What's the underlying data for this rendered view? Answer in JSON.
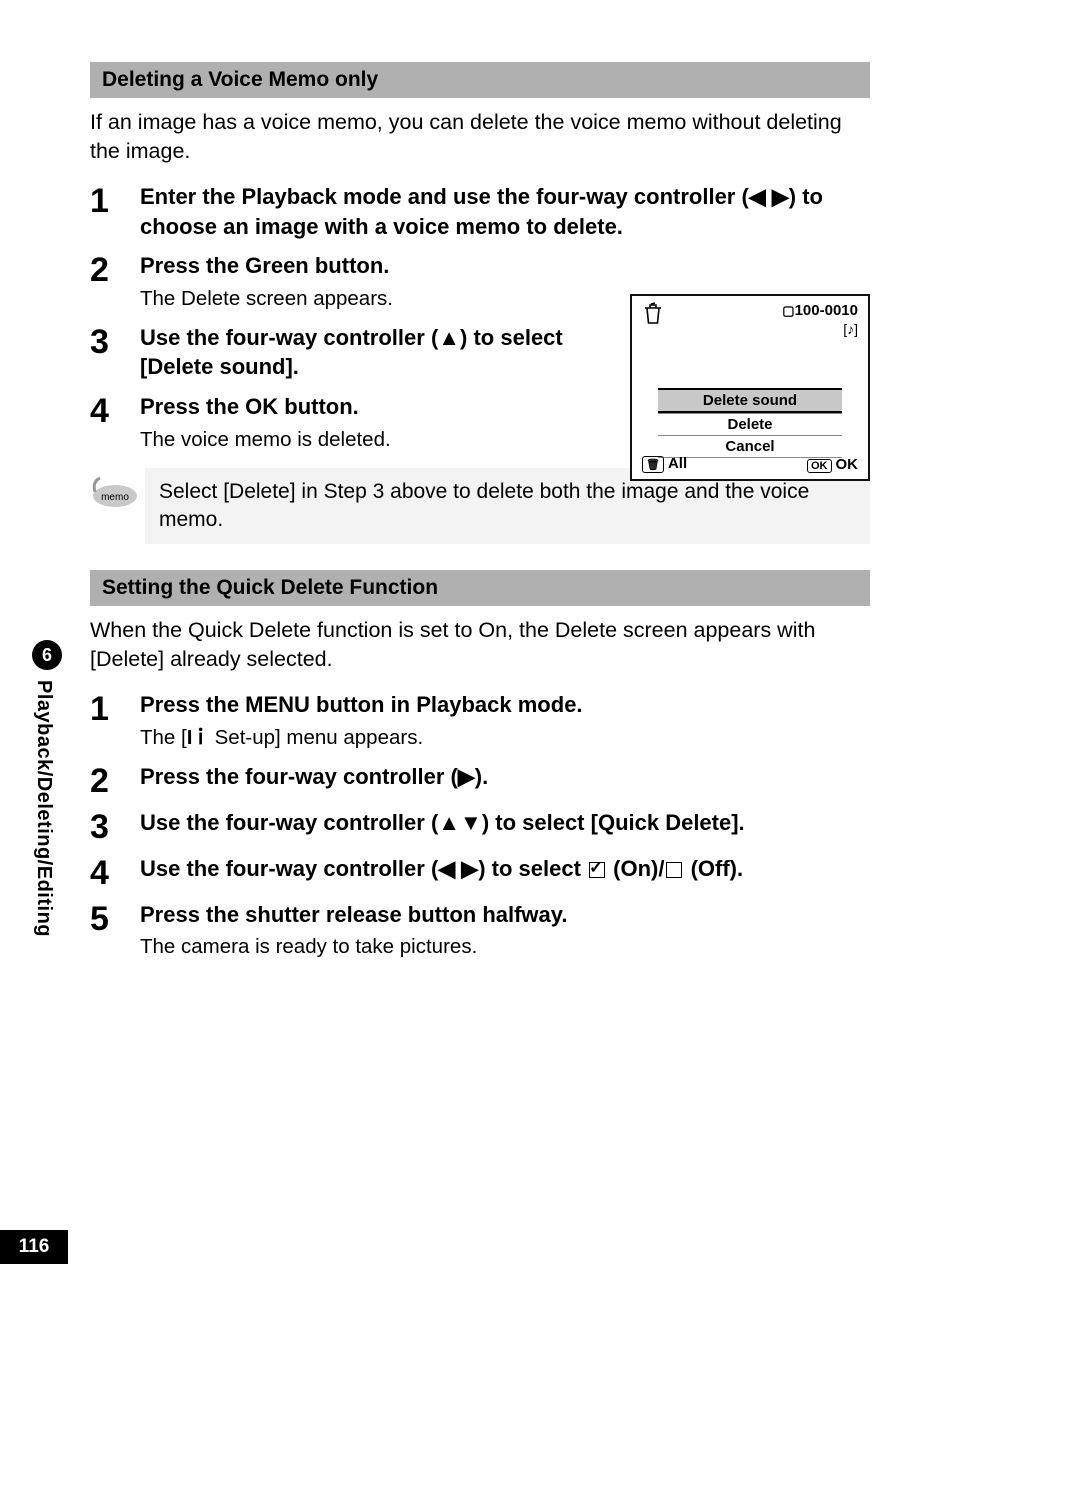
{
  "section1": {
    "title": "Deleting a Voice Memo only",
    "intro": "If an image has a voice memo, you can delete the voice memo without deleting the image.",
    "steps": [
      {
        "n": "1",
        "title": "Enter the Playback mode and use the four-way controller (◀ ▶) to choose an image with a voice memo to delete."
      },
      {
        "n": "2",
        "title": "Press the Green button.",
        "sub": "The Delete screen appears."
      },
      {
        "n": "3",
        "title": "Use the four-way controller (▲) to select [Delete sound]."
      },
      {
        "n": "4",
        "title": "Press the OK button.",
        "sub": "The voice memo is deleted."
      }
    ],
    "memo": "Select [Delete] in Step 3 above to delete both the image and the voice memo."
  },
  "screen": {
    "file_no": "100-0010",
    "menu": {
      "opt1": "Delete sound",
      "opt2": "Delete",
      "opt3": "Cancel"
    },
    "left_label": "All",
    "right_box": "OK",
    "right_label": "OK"
  },
  "section2": {
    "title": "Setting the Quick Delete Function",
    "intro": "When the Quick Delete function is set to On, the Delete screen appears with [Delete] already selected.",
    "steps": [
      {
        "n": "1",
        "title": "Press the MENU button in Playback mode.",
        "sub_pre": "The [",
        "sub_post": " Set-up] menu appears."
      },
      {
        "n": "2",
        "title": "Press the four-way controller (▶)."
      },
      {
        "n": "3",
        "title": "Use the four-way controller (▲▼) to select [Quick Delete]."
      },
      {
        "n": "4",
        "title_pre": "Use the four-way controller (◀ ▶) to select ",
        "title_mid": " (On)/",
        "title_post": " (Off)."
      },
      {
        "n": "5",
        "title": "Press the shutter release button halfway.",
        "sub": "The camera is ready to take pictures."
      }
    ]
  },
  "side": {
    "chapter": "6",
    "label": "Playback/Deleting/Editing"
  },
  "page_no": "116",
  "memo_label": "memo"
}
